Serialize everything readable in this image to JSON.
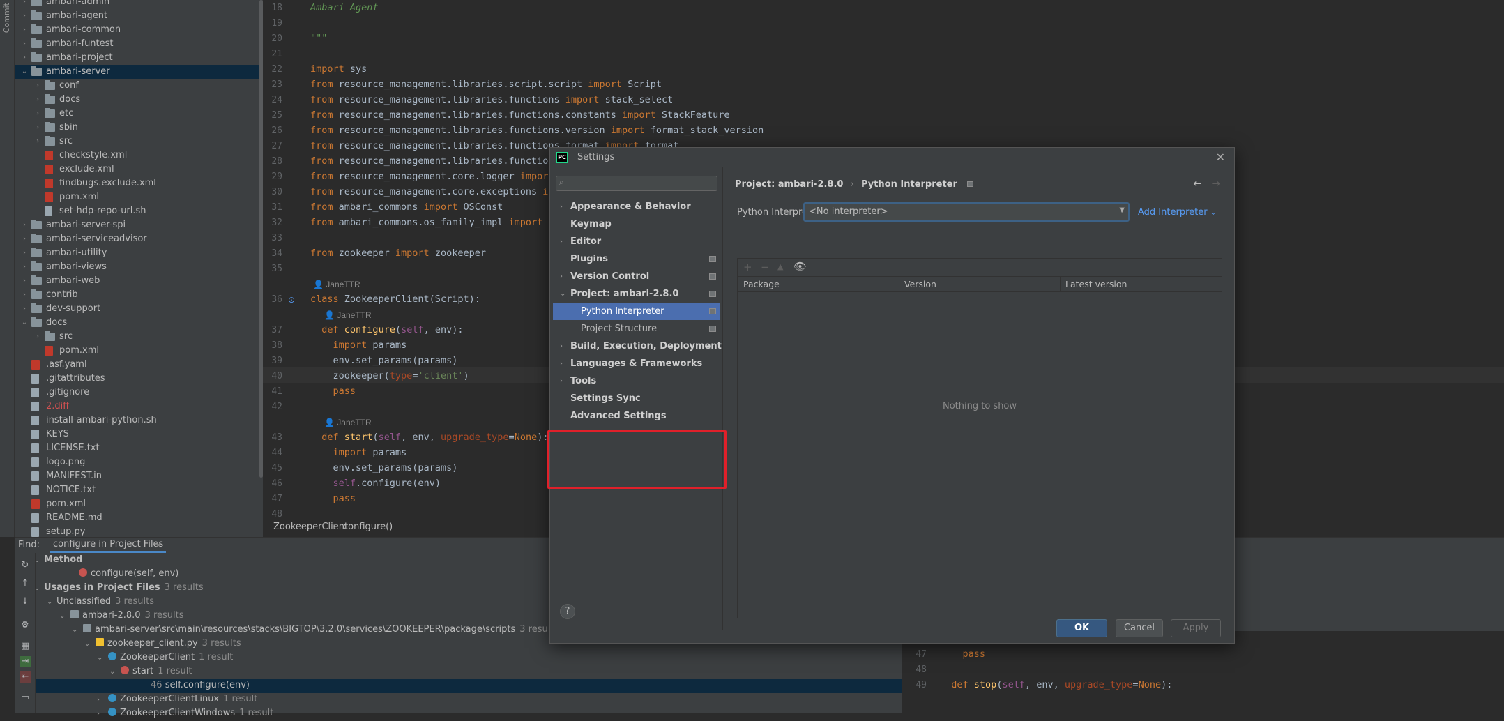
{
  "left_strip": {
    "commit_label": "Commit"
  },
  "project_tree": [
    {
      "label": "ambari-admin",
      "level": 1,
      "kind": "folder",
      "expanded": false
    },
    {
      "label": "ambari-agent",
      "level": 1,
      "kind": "folder",
      "expanded": false
    },
    {
      "label": "ambari-common",
      "level": 1,
      "kind": "folder",
      "expanded": false
    },
    {
      "label": "ambari-funtest",
      "level": 1,
      "kind": "folder",
      "expanded": false
    },
    {
      "label": "ambari-project",
      "level": 1,
      "kind": "folder",
      "expanded": false
    },
    {
      "label": "ambari-server",
      "level": 1,
      "kind": "folder",
      "expanded": true,
      "selected": true
    },
    {
      "label": "conf",
      "level": 2,
      "kind": "folder",
      "expanded": false
    },
    {
      "label": "docs",
      "level": 2,
      "kind": "folder",
      "expanded": false
    },
    {
      "label": "etc",
      "level": 2,
      "kind": "folder",
      "expanded": false
    },
    {
      "label": "sbin",
      "level": 2,
      "kind": "folder",
      "expanded": false
    },
    {
      "label": "src",
      "level": 2,
      "kind": "folder",
      "expanded": false
    },
    {
      "label": "checkstyle.xml",
      "level": 2,
      "kind": "xml"
    },
    {
      "label": "exclude.xml",
      "level": 2,
      "kind": "xml"
    },
    {
      "label": "findbugs.exclude.xml",
      "level": 2,
      "kind": "xml"
    },
    {
      "label": "pom.xml",
      "level": 2,
      "kind": "xml"
    },
    {
      "label": "set-hdp-repo-url.sh",
      "level": 2,
      "kind": "file"
    },
    {
      "label": "ambari-server-spi",
      "level": 1,
      "kind": "folder",
      "expanded": false
    },
    {
      "label": "ambari-serviceadvisor",
      "level": 1,
      "kind": "folder",
      "expanded": false
    },
    {
      "label": "ambari-utility",
      "level": 1,
      "kind": "folder",
      "expanded": false
    },
    {
      "label": "ambari-views",
      "level": 1,
      "kind": "folder",
      "expanded": false
    },
    {
      "label": "ambari-web",
      "level": 1,
      "kind": "folder",
      "expanded": false
    },
    {
      "label": "contrib",
      "level": 1,
      "kind": "folder",
      "expanded": false
    },
    {
      "label": "dev-support",
      "level": 1,
      "kind": "folder",
      "expanded": false
    },
    {
      "label": "docs",
      "level": 1,
      "kind": "folder",
      "expanded": true
    },
    {
      "label": "src",
      "level": 2,
      "kind": "folder",
      "expanded": false
    },
    {
      "label": "pom.xml",
      "level": 2,
      "kind": "xml"
    },
    {
      "label": ".asf.yaml",
      "level": 1,
      "kind": "xml"
    },
    {
      "label": ".gitattributes",
      "level": 1,
      "kind": "file"
    },
    {
      "label": ".gitignore",
      "level": 1,
      "kind": "file"
    },
    {
      "label": "2.diff",
      "level": 1,
      "kind": "file",
      "red": true
    },
    {
      "label": "install-ambari-python.sh",
      "level": 1,
      "kind": "file"
    },
    {
      "label": "KEYS",
      "level": 1,
      "kind": "file"
    },
    {
      "label": "LICENSE.txt",
      "level": 1,
      "kind": "file"
    },
    {
      "label": "logo.png",
      "level": 1,
      "kind": "file"
    },
    {
      "label": "MANIFEST.in",
      "level": 1,
      "kind": "file"
    },
    {
      "label": "NOTICE.txt",
      "level": 1,
      "kind": "file"
    },
    {
      "label": "pom.xml",
      "level": 1,
      "kind": "xml"
    },
    {
      "label": "README.md",
      "level": 1,
      "kind": "file"
    },
    {
      "label": "setup.py",
      "level": 1,
      "kind": "file"
    }
  ],
  "editor": {
    "lines": [
      {
        "n": "18",
        "html": "<span class=\"cm\">Ambari Agent</span>"
      },
      {
        "n": "19",
        "html": ""
      },
      {
        "n": "20",
        "html": "<span class=\"cm\">\"\"\"</span>"
      },
      {
        "n": "21",
        "html": ""
      },
      {
        "n": "22",
        "html": "<span class=\"kw\">import</span> sys"
      },
      {
        "n": "23",
        "html": "<span class=\"kw\">from</span> resource_management.libraries.script.script <span class=\"kw\">import</span> Script"
      },
      {
        "n": "24",
        "html": "<span class=\"kw\">from</span> resource_management.libraries.functions <span class=\"kw\">import</span> stack_select"
      },
      {
        "n": "25",
        "html": "<span class=\"kw\">from</span> resource_management.libraries.functions.constants <span class=\"kw\">import</span> StackFeature"
      },
      {
        "n": "26",
        "html": "<span class=\"kw\">from</span> resource_management.libraries.functions.version <span class=\"kw\">import</span> format_stack_version"
      },
      {
        "n": "27",
        "html": "<span class=\"kw\">from</span> resource_management.libraries.functions.format <span class=\"kw\">import</span> format"
      },
      {
        "n": "28",
        "html": "<span class=\"kw\">from</span> resource_management.libraries.functions.stack_features <span class=\"kw\">import</span> check_stack_feature"
      },
      {
        "n": "29",
        "html": "<span class=\"kw\">from</span> resource_management.core.logger <span class=\"kw\">import</span> Logger"
      },
      {
        "n": "30",
        "html": "<span class=\"kw\">from</span> resource_management.core.exceptions <span class=\"kw\">import</span> ClientComponentHasNoStatus"
      },
      {
        "n": "31",
        "html": "<span class=\"kw\">from</span> ambari_commons <span class=\"kw\">import</span> OSConst"
      },
      {
        "n": "32",
        "html": "<span class=\"kw\">from</span> ambari_commons.os_family_impl <span class=\"kw\">import</span> OsFamilyImpl"
      },
      {
        "n": "33",
        "html": ""
      },
      {
        "n": "34",
        "html": "<span class=\"kw\">from</span> zookeeper <span class=\"kw\">import</span> zookeeper"
      },
      {
        "n": "35",
        "html": ""
      },
      {
        "n": "",
        "html": "",
        "hint": "JaneTTR",
        "indent": 0
      },
      {
        "n": "36",
        "html": "<span class=\"kw\">class</span> ZookeeperClient(Script):"
      },
      {
        "n": "",
        "html": "",
        "hint": "JaneTTR",
        "indent": 1
      },
      {
        "n": "37",
        "html": "  <span class=\"kw\">def</span> <span class=\"fn\">configure</span>(<span class=\"self\">self</span>, env):"
      },
      {
        "n": "38",
        "html": "    <span class=\"kw\">import</span> params"
      },
      {
        "n": "39",
        "html": "    env.set_params(params)"
      },
      {
        "n": "40",
        "html": "    zookeeper(<span class=\"par\">type</span>=<span class=\"str\">'client'</span>)"
      },
      {
        "n": "41",
        "html": "    <span class=\"kw\">pass</span>"
      },
      {
        "n": "42",
        "html": ""
      },
      {
        "n": "",
        "html": "",
        "hint": "JaneTTR",
        "indent": 1
      },
      {
        "n": "43",
        "html": "  <span class=\"kw\">def</span> <span class=\"fn\">start</span>(<span class=\"self\">self</span>, env, <span class=\"par\">upgrade_type</span>=<span class=\"kw\">None</span>):"
      },
      {
        "n": "44",
        "html": "    <span class=\"kw\">import</span> params"
      },
      {
        "n": "45",
        "html": "    env.set_params(params)"
      },
      {
        "n": "46",
        "html": "    <span class=\"self\">self</span>.configure(env)"
      },
      {
        "n": "47",
        "html": "    <span class=\"kw\">pass</span>"
      },
      {
        "n": "48",
        "html": ""
      }
    ],
    "breadcrumb": [
      "ZookeeperClient",
      "configure()"
    ]
  },
  "find": {
    "title": "Find:",
    "tab_label": "configure in Project Files",
    "method_header": "Method",
    "method_item": "configure(self, env)",
    "usages_label": "Usages in Project Files",
    "usages_count": "3 results",
    "unclassified": "Unclassified",
    "unclassified_count": "3 results",
    "project": "ambari-2.8.0",
    "project_count": "3 results",
    "path": "ambari-server\\src\\main\\resources\\stacks\\BIGTOP\\3.2.0\\services\\ZOOKEEPER\\package\\scripts",
    "path_count": "3 results",
    "file": "zookeeper_client.py",
    "file_count": "3 results",
    "cls": "ZookeeperClient",
    "cls_count": "1 result",
    "method_start": "start",
    "method_start_count": "1 result",
    "usage_line_no": "46",
    "usage_text": "self.configure(env)",
    "cls2": "ZookeeperClientLinux",
    "cls2_count": "1 result",
    "cls3": "ZookeeperClientWindows",
    "cls3_count": "1 result",
    "code_lines": [
      {
        "n": "46",
        "html": "    <span class=\"self\">self</span>.configure(env)"
      },
      {
        "n": "47",
        "html": "    <span class=\"kw\">pass</span>"
      },
      {
        "n": "48",
        "html": ""
      },
      {
        "n": "49",
        "html": "  <span class=\"kw\">def</span> <span class=\"fn\">stop</span>(<span class=\"self\">self</span>, env, <span class=\"par\">upgrade_type</span>=<span class=\"kw\">None</span>):"
      }
    ]
  },
  "dialog": {
    "title": "Settings",
    "search_placeholder": "",
    "nav": [
      {
        "label": "Appearance & Behavior",
        "bold": true,
        "arrow": "collapsed"
      },
      {
        "label": "Keymap",
        "bold": true
      },
      {
        "label": "Editor",
        "bold": true,
        "arrow": "collapsed"
      },
      {
        "label": "Plugins",
        "bold": true,
        "pin": true
      },
      {
        "label": "Version Control",
        "bold": true,
        "arrow": "collapsed",
        "pin": true
      },
      {
        "label": "Project: ambari-2.8.0",
        "bold": true,
        "arrow": "expanded",
        "pin": true
      },
      {
        "label": "Python Interpreter",
        "child": true,
        "selected": true,
        "pin": true
      },
      {
        "label": "Project Structure",
        "child": true,
        "pin": true
      },
      {
        "label": "Build, Execution, Deployment",
        "bold": true,
        "arrow": "collapsed"
      },
      {
        "label": "Languages & Frameworks",
        "bold": true,
        "arrow": "collapsed"
      },
      {
        "label": "Tools",
        "bold": true,
        "arrow": "collapsed"
      },
      {
        "label": "Settings Sync",
        "bold": true
      },
      {
        "label": "Advanced Settings",
        "bold": true
      }
    ],
    "breadcrumb_project": "Project: ambari-2.8.0",
    "breadcrumb_page": "Python Interpreter",
    "interpreter_label": "Python Interpreter:",
    "interpreter_value": "<No interpreter>",
    "add_interpreter": "Add Interpreter",
    "columns": [
      "Package",
      "Version",
      "Latest version"
    ],
    "empty_text": "Nothing to show",
    "ok": "OK",
    "cancel": "Cancel",
    "apply": "Apply"
  }
}
